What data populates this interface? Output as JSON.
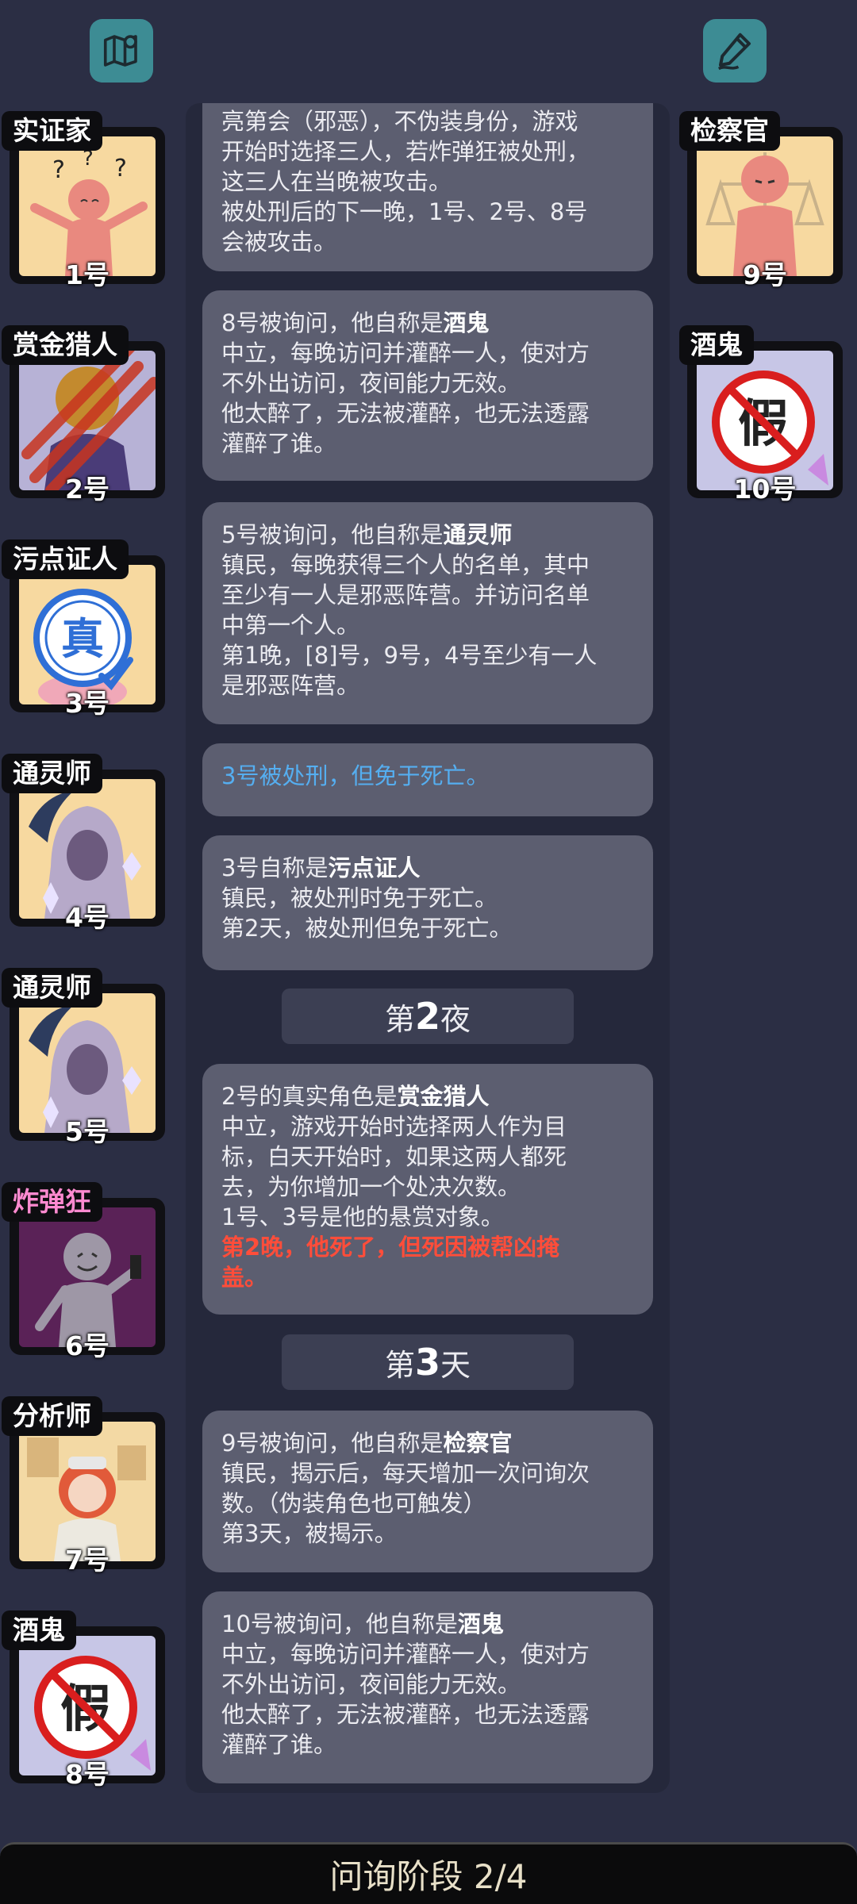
{
  "top_bar": {
    "left_icon": "map-icon",
    "right_icon": "notes-pen-icon"
  },
  "players_left": [
    {
      "role": "实证家",
      "seat": "1号",
      "art": "confused-figure"
    },
    {
      "role": "赏金猎人",
      "seat": "2号",
      "art": "clawed-hunter"
    },
    {
      "role": "污点证人",
      "seat": "3号",
      "art": "true-stamp"
    },
    {
      "role": "通灵师",
      "seat": "4号",
      "art": "hooded-medium"
    },
    {
      "role": "通灵师",
      "seat": "5号",
      "art": "hooded-medium"
    },
    {
      "role": "炸弹狂",
      "seat": "6号",
      "art": "bomber-figure"
    },
    {
      "role": "分析师",
      "seat": "7号",
      "art": "analyst-girl"
    },
    {
      "role": "酒鬼",
      "seat": "8号",
      "art": "fake-stamp"
    }
  ],
  "players_right": [
    {
      "role": "检察官",
      "seat": "9号",
      "art": "prosecutor-figure"
    },
    {
      "role": "酒鬼",
      "seat": "10号",
      "art": "fake-stamp"
    }
  ],
  "log": {
    "card1": {
      "l1": "亮第会（邪恶），不伪装身份，游戏",
      "l2": "开始时选择三人，若炸弹狂被处刑，",
      "l3": "这三人在当晚被攻击。",
      "l4": "被处刑后的下一晚，1号、2号、8号",
      "l5": "会被攻击。"
    },
    "card2": {
      "pre": "8号被询问，他自称是",
      "role": "酒鬼",
      "l2": "中立，每晚访问并灌醉一人，使对方",
      "l3": "不外出访问，夜间能力无效。",
      "l4": "他太醉了，无法被灌醉，也无法透露",
      "l5": "灌醉了谁。"
    },
    "card3": {
      "pre": "5号被询问，他自称是",
      "role": "通灵师",
      "l2": "镇民，每晚获得三个人的名单，其中",
      "l3": "至少有一人是邪恶阵营。并访问名单",
      "l4": "中第一个人。",
      "l5": "第1晚，[8]号，9号，4号至少有一人",
      "l6": "是邪恶阵营。"
    },
    "card4": {
      "text": "3号被处刑，但免于死亡。"
    },
    "card5": {
      "pre": "3号自称是",
      "role": "污点证人",
      "l2": "镇民，被处刑时免于死亡。",
      "l3": "第2天，被处刑但免于死亡。"
    },
    "banner1": {
      "pre": "第",
      "num": "2",
      "post": "夜"
    },
    "card6": {
      "pre": "2号的真实角色是",
      "role": "赏金猎人",
      "l2": "中立，游戏开始时选择两人作为目",
      "l3": "标，白天开始时，如果这两人都死",
      "l4": "去，为你增加一个处决次数。",
      "l5": "1号、3号是他的悬赏对象。",
      "r1": "第2晚，他死了，但死因被帮凶掩",
      "r2": "盖。"
    },
    "banner2": {
      "pre": "第",
      "num": "3",
      "post": "天"
    },
    "card7": {
      "pre": "9号被询问，他自称是",
      "role": "检察官",
      "l2": "镇民，揭示后，每天增加一次问询次",
      "l3": "数。（伪装角色也可触发）",
      "l4": "第3天，被揭示。"
    },
    "card8": {
      "pre": "10号被询问，他自称是",
      "role": "酒鬼",
      "l2": "中立，每晚访问并灌醉一人，使对方",
      "l3": "不外出访问，夜间能力无效。",
      "l4": "他太醉了，无法被灌醉，也无法透露",
      "l5": "灌醉了谁。"
    }
  },
  "phase": {
    "label": "问询阶段 2/4"
  }
}
